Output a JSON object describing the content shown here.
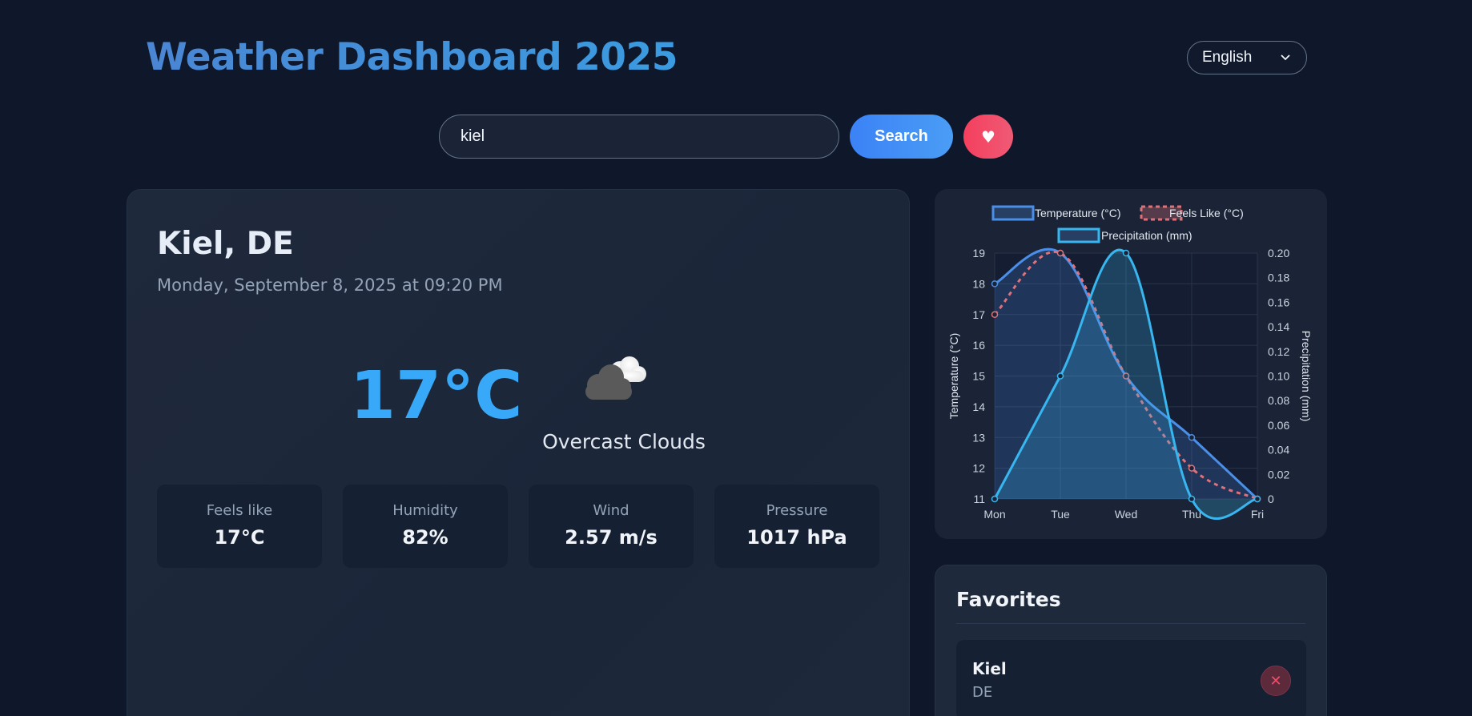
{
  "header": {
    "title": "Weather Dashboard 2025",
    "language": "English"
  },
  "search": {
    "value": "kiel",
    "button_label": "Search",
    "favorite_label": "♥"
  },
  "current": {
    "city": "Kiel, DE",
    "datetime": "Monday, September 8, 2025 at 09:20 PM",
    "temperature": "17°C",
    "icon": "overcast-clouds-icon",
    "description": "Overcast Clouds",
    "stats": [
      {
        "label": "Feels like",
        "value": "17°C"
      },
      {
        "label": "Humidity",
        "value": "82%"
      },
      {
        "label": "Wind",
        "value": "2.57 m/s"
      },
      {
        "label": "Pressure",
        "value": "1017 hPa"
      }
    ]
  },
  "chart_data": {
    "type": "line",
    "categories": [
      "Mon",
      "Tue",
      "Wed",
      "Thu",
      "Fri"
    ],
    "series": [
      {
        "name": "Temperature (°C)",
        "axis": "left",
        "values": [
          18,
          19,
          15,
          13,
          11
        ],
        "color": "#4a8ee8",
        "dashed": false
      },
      {
        "name": "Feels Like (°C)",
        "axis": "left",
        "values": [
          17,
          19,
          15,
          12,
          11
        ],
        "color": "#e0707a",
        "dashed": true
      },
      {
        "name": "Precipitation (mm)",
        "axis": "right",
        "values": [
          0,
          0.1,
          0.2,
          0,
          0
        ],
        "color": "#38b6f0",
        "dashed": false
      }
    ],
    "ylabel": "Temperature (°C)",
    "y2label": "Precipitation (mm)",
    "ylim": [
      11,
      19
    ],
    "y2lim": [
      0,
      0.2
    ],
    "yticks": [
      "19",
      "18",
      "17",
      "16",
      "15",
      "14",
      "13",
      "12",
      "11"
    ],
    "y2ticks": [
      "0.20",
      "0.18",
      "0.16",
      "0.14",
      "0.12",
      "0.10",
      "0.08",
      "0.06",
      "0.04",
      "0.02",
      "0"
    ],
    "legend": "top",
    "grid": true
  },
  "favorites": {
    "title": "Favorites",
    "items": [
      {
        "city": "Kiel",
        "country": "DE",
        "remove_label": "✕"
      }
    ]
  },
  "colors": {
    "background": "#0f172a",
    "accent": "#38a9f8",
    "card": "#1e293b",
    "danger": "#f43f5e"
  }
}
